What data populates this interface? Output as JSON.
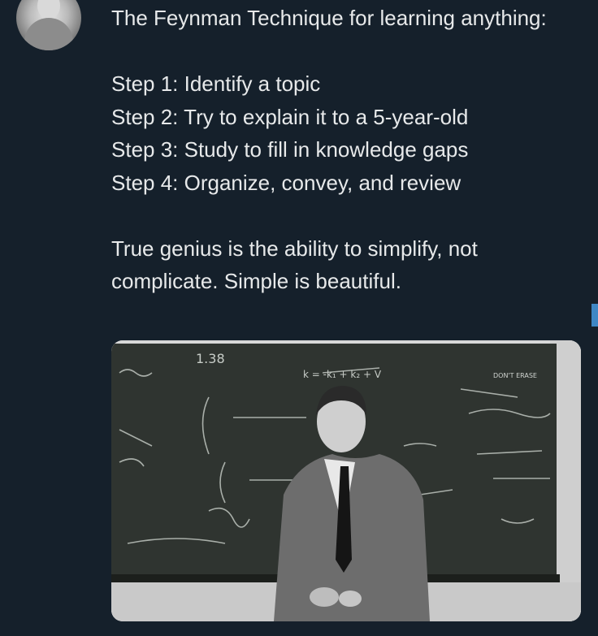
{
  "tweet": {
    "avatar_icon": "profile-avatar-icon",
    "text": "The Feynman Technique for learning anything:\n\nStep 1: Identify a topic\nStep 2: Try to explain it to a 5-year-old\nStep 3: Study to fill in knowledge gaps\nStep 4: Organize, convey, and review\n\nTrue genius is the ability to simplify, not complicate. Simple is beautiful.",
    "media": {
      "icon": "blackboard-photo-icon",
      "chalk_text_1": "1.38",
      "chalk_text_2": "k = -k₁ + k₂ + V",
      "chalk_text_3": "DON'T ERASE"
    }
  },
  "colors": {
    "background": "#15202b",
    "text": "#e7e9ea",
    "accent": "#3f87c5"
  }
}
